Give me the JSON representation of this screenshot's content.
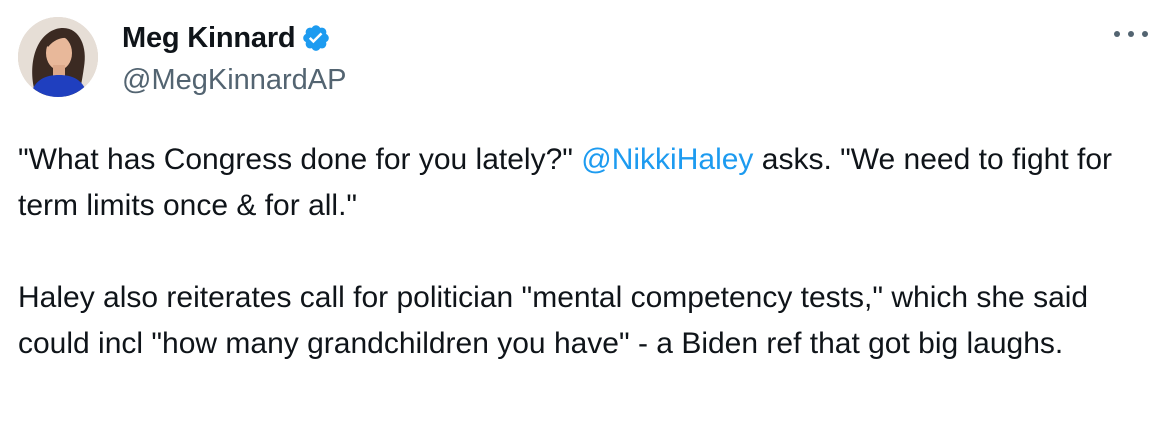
{
  "author": {
    "display_name": "Meg Kinnard",
    "handle": "@MegKinnardAP",
    "verified_icon": "verified-badge-icon",
    "avatar_icon": "avatar-photo"
  },
  "menu": {
    "icon": "more-options-icon"
  },
  "tweet": {
    "p1_part1": "\"What has Congress done for you lately?\" ",
    "p1_mention": "@NikkiHaley",
    "p1_part2": " asks. \"We need to fight for term limits once & for all.\"",
    "p2": "Haley also reiterates call for politician \"mental competency tests,\" which she said could incl \"how many grandchildren you have\" - a Biden ref that got big laughs."
  },
  "colors": {
    "text": "#0f1419",
    "secondary": "#536471",
    "accent": "#1d9bf0"
  }
}
